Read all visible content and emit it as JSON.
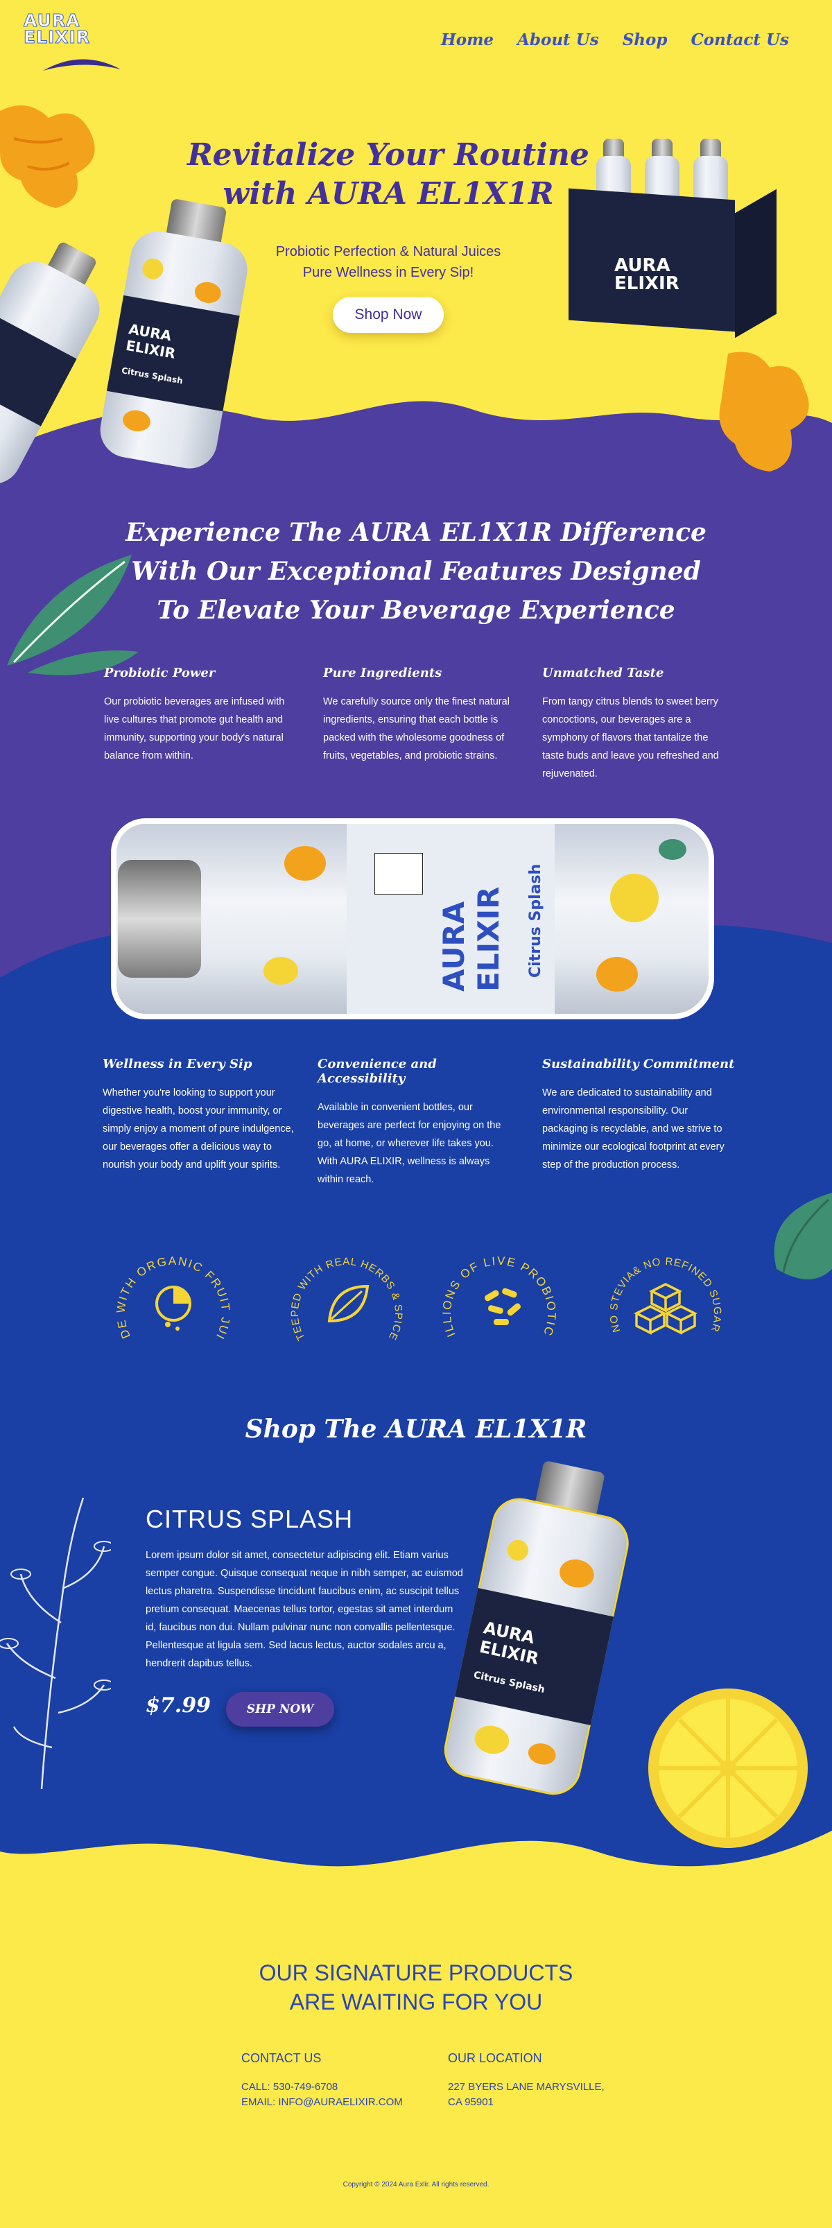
{
  "brand": {
    "logo_line1": "AURA",
    "logo_line2": "ELIXIR"
  },
  "nav": {
    "items": [
      "Home",
      "About Us",
      "Shop",
      "Contact Us"
    ]
  },
  "hero": {
    "title": "Revitalize Your Routine with AURA EL1X1R",
    "subtitle_line1": "Probiotic Perfection & Natural Juices",
    "subtitle_line2": "Pure Wellness in Every Sip!",
    "button": "Shop Now"
  },
  "bottle": {
    "brand_line1": "AURA",
    "brand_line2": "ELIXIR",
    "flavor": "Citrus Splash"
  },
  "features": {
    "title": "Experience The AURA EL1X1R Difference With Our Exceptional Features Designed To Elevate Your Beverage Experience",
    "items": [
      {
        "title": "Probiotic Power",
        "text": "Our probiotic beverages are infused with live cultures that promote gut health and immunity, supporting your body's natural balance from within."
      },
      {
        "title": "Pure Ingredients",
        "text": "We carefully source only the finest natural ingredients, ensuring that each bottle is packed with the wholesome goodness of fruits, vegetables, and probiotic strains."
      },
      {
        "title": "Unmatched Taste",
        "text": " From tangy citrus blends to sweet berry concoctions, our beverages are a symphony of flavors that tantalize the taste buds and leave you refreshed and rejuvenated."
      },
      {
        "title": "Wellness in Every Sip",
        "text": "Whether you're looking to support your digestive health, boost your immunity, or simply enjoy a moment of pure indulgence, our beverages offer a delicious way to nourish your body and uplift your spirits."
      },
      {
        "title": "Convenience and Accessibility",
        "text": " Available in convenient bottles, our beverages are perfect for enjoying on the go, at home, or wherever life takes you. With AURA ELIXIR, wellness is always within reach."
      },
      {
        "title": "Sustainability Commitment",
        "text": "We are dedicated to sustainability and environmental responsibility. Our packaging is recyclable, and we strive to minimize our ecological footprint at every step of the production process."
      }
    ]
  },
  "badges": [
    {
      "text": "MADE WITH ORGANIC FRUIT JUICE",
      "icon": "lemon-slice-icon"
    },
    {
      "text": "STEEPED WITH REAL HERBS & SPICES",
      "icon": "leaf-icon"
    },
    {
      "text": "BILLIONS OF LIVE PROBIOTICS",
      "icon": "probiotics-icon"
    },
    {
      "text": "NO STEVIA& NO REFINED SUGAR",
      "icon": "sugar-cubes-icon"
    }
  ],
  "shop": {
    "title": "Shop The AURA EL1X1R",
    "product_name": "CITRUS SPLASH",
    "description": "Lorem ipsum dolor sit amet, consectetur adipiscing elit. Etiam varius semper congue. Quisque consequat neque in nibh semper, ac euismod lectus pharetra. Suspendisse tincidunt faucibus enim, ac suscipit tellus pretium consequat. Maecenas tellus tortor, egestas sit amet interdum id, faucibus non dui. Nullam pulvinar nunc non convallis pellentesque. Pellentesque at ligula sem. Sed lacus lectus, auctor sodales arcu a, hendrerit dapibus tellus.",
    "price": "$7.99",
    "button": "SHP NOW"
  },
  "footer": {
    "headline_line1": "OUR SIGNATURE PRODUCTS",
    "headline_line2": "ARE WAITING FOR YOU",
    "contact_title": "CONTACT US",
    "contact_phone": "CALL: 530-749-6708",
    "contact_email": "EMAIL: INFO@AURAELIXIR.COM",
    "location_title": "OUR LOCATION",
    "location_line1": "227 BYERS LANE MARYSVILLE,",
    "location_line2": "CA 95901",
    "copyright": "Copyright © 2024 Aura Exlir. All rights reserved."
  },
  "colors": {
    "yellow": "#fce94a",
    "purple": "#4e3ea0",
    "blue": "#1a3fa5",
    "heading_purple": "#4330a0",
    "footer_blue": "#2a45b5"
  }
}
